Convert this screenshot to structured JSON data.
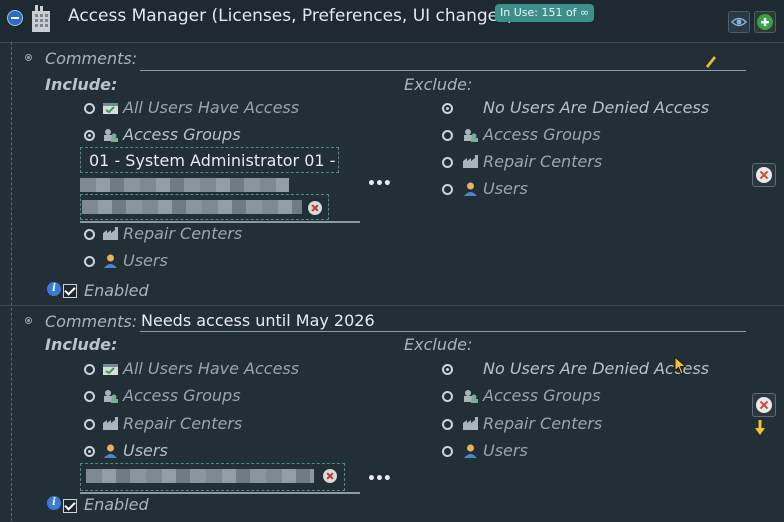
{
  "header": {
    "title": "Access Manager (Licenses, Preferences, UI changes)",
    "badge": "In Use: 151 of ∞"
  },
  "labels": {
    "comments": "Comments:",
    "include": "Include:",
    "exclude": "Exclude:",
    "enabled": "Enabled"
  },
  "include_options": [
    {
      "label": "All Users Have Access",
      "icon": "users-access-icon"
    },
    {
      "label": "Access Groups",
      "icon": "access-groups-icon"
    },
    {
      "label": "Repair Centers",
      "icon": "repair-centers-icon"
    },
    {
      "label": "Users",
      "icon": "user-icon"
    }
  ],
  "exclude_options": [
    {
      "label": "No Users Are Denied Access",
      "icon": ""
    },
    {
      "label": "Access Groups",
      "icon": "access-groups-icon"
    },
    {
      "label": "Repair Centers",
      "icon": "repair-centers-icon"
    },
    {
      "label": "Users",
      "icon": "user-icon"
    }
  ],
  "rules": [
    {
      "comment": "",
      "include_selected": "Access Groups",
      "exclude_selected": "No Users Are Denied Access",
      "selected_value": "01 - System Administrator 01 -",
      "enabled": true
    },
    {
      "comment": "Needs access until May 2026",
      "include_selected": "Users",
      "exclude_selected": "No Users Are Denied Access",
      "selected_value": "",
      "enabled": true
    }
  ],
  "more_label": "•••",
  "colors": {
    "accent": "#3d8f8a",
    "danger": "#d24a30",
    "info": "#3a7ad8"
  }
}
